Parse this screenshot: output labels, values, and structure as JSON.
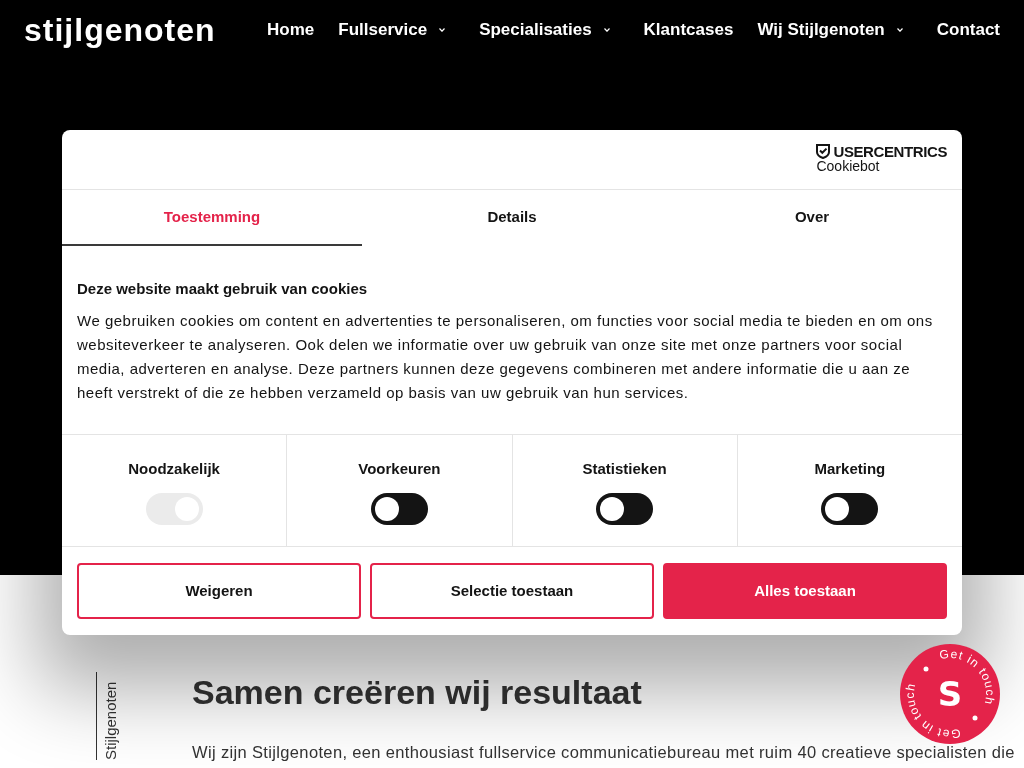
{
  "header": {
    "logo": "stijlgenoten",
    "nav": [
      {
        "label": "Home",
        "submenu": false
      },
      {
        "label": "Fullservice",
        "submenu": true
      },
      {
        "label": "Specialisaties",
        "submenu": true
      },
      {
        "label": "Klantcases",
        "submenu": false
      },
      {
        "label": "Wij Stijlgenoten",
        "submenu": true
      },
      {
        "label": "Contact",
        "submenu": false
      }
    ]
  },
  "cookie_dialog": {
    "brand": {
      "name": "USERCENTRICS",
      "product": "Cookiebot"
    },
    "tabs": [
      {
        "label": "Toestemming",
        "selected": true
      },
      {
        "label": "Details",
        "selected": false
      },
      {
        "label": "Over",
        "selected": false
      }
    ],
    "title": "Deze website maakt gebruik van cookies",
    "text": "We gebruiken cookies om content en advertenties te personaliseren, om functies voor social media te bieden en om ons websiteverkeer te analyseren. Ook delen we informatie over uw gebruik van onze site met onze partners voor social media, adverteren en analyse. Deze partners kunnen deze gegevens combineren met andere informatie die u aan ze heeft verstrekt of die ze hebben verzameld op basis van uw gebruik van hun services.",
    "categories": [
      {
        "label": "Noodzakelijk",
        "on": true,
        "disabled": true
      },
      {
        "label": "Voorkeuren",
        "on": false,
        "disabled": false
      },
      {
        "label": "Statistieken",
        "on": false,
        "disabled": false
      },
      {
        "label": "Marketing",
        "on": false,
        "disabled": false
      }
    ],
    "buttons": [
      {
        "label": "Weigeren",
        "kind": "outline"
      },
      {
        "label": "Selectie toestaan",
        "kind": "outline"
      },
      {
        "label": "Alles toestaan",
        "kind": "filled"
      }
    ]
  },
  "page": {
    "side_label": "Stijlgenoten",
    "heading": "Samen creëren wij resultaat",
    "intro": "Wij zijn Stijlgenoten, een enthousiast fullservice communicatiebureau met ruim 40 creatieve specialisten die"
  },
  "contact_badge": {
    "ring_texts": [
      "Get in touch",
      "Get in touch"
    ],
    "mark": "S"
  }
}
